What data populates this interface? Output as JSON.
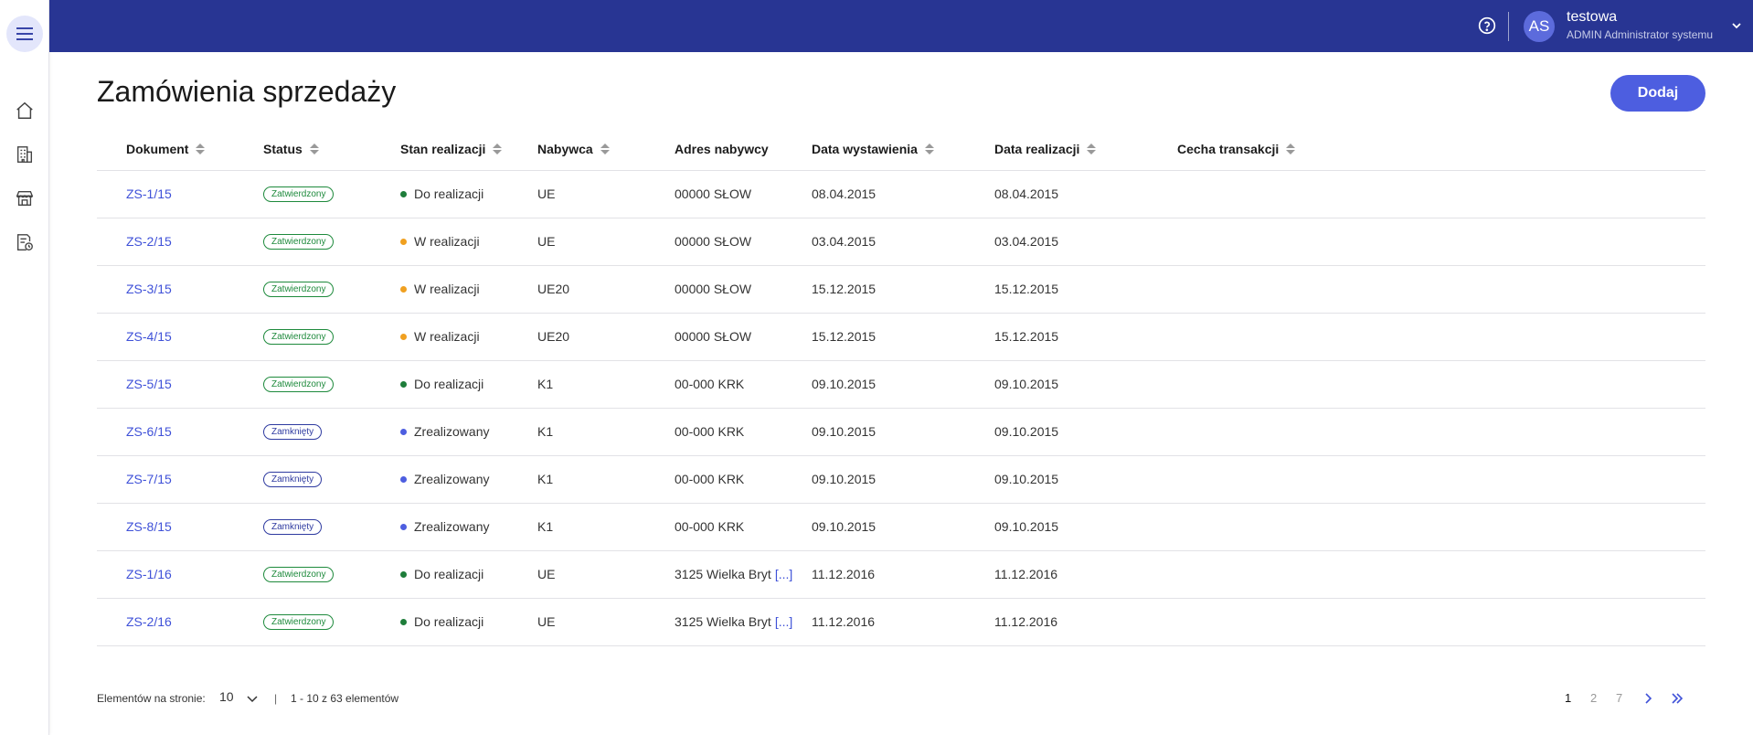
{
  "header": {
    "user_initials": "AS",
    "user_name": "testowa",
    "user_role": "ADMIN Administrator systemu"
  },
  "sidebar": {
    "items": [
      {
        "icon": "home-icon"
      },
      {
        "icon": "building-icon"
      },
      {
        "icon": "store-icon"
      },
      {
        "icon": "document-clock-icon"
      }
    ]
  },
  "page": {
    "title": "Zamówienia sprzedaży",
    "add_label": "Dodaj"
  },
  "table": {
    "columns": [
      "Dokument",
      "Status",
      "Stan realizacji",
      "Nabywca",
      "Adres nabywcy",
      "Data wystawienia",
      "Data realizacji",
      "Cecha transakcji"
    ],
    "rows": [
      {
        "doc": "ZS-1/15",
        "status": "Zatwierdzony",
        "status_type": "green",
        "stage": "Do realizacji",
        "stage_color": "#1e7d3a",
        "buyer": "UE",
        "address": "00000 SŁOW",
        "address_more": "",
        "issued": "08.04.2015",
        "completed": "08.04.2015"
      },
      {
        "doc": "ZS-2/15",
        "status": "Zatwierdzony",
        "status_type": "green",
        "stage": "W realizacji",
        "stage_color": "#f0a020",
        "buyer": "UE",
        "address": "00000 SŁOW",
        "address_more": "",
        "issued": "03.04.2015",
        "completed": "03.04.2015"
      },
      {
        "doc": "ZS-3/15",
        "status": "Zatwierdzony",
        "status_type": "green",
        "stage": "W realizacji",
        "stage_color": "#f0a020",
        "buyer": "UE20",
        "address": "00000 SŁOW",
        "address_more": "",
        "issued": "15.12.2015",
        "completed": "15.12.2015"
      },
      {
        "doc": "ZS-4/15",
        "status": "Zatwierdzony",
        "status_type": "green",
        "stage": "W realizacji",
        "stage_color": "#f0a020",
        "buyer": "UE20",
        "address": "00000 SŁOW",
        "address_more": "",
        "issued": "15.12.2015",
        "completed": "15.12.2015"
      },
      {
        "doc": "ZS-5/15",
        "status": "Zatwierdzony",
        "status_type": "green",
        "stage": "Do realizacji",
        "stage_color": "#1e7d3a",
        "buyer": "K1",
        "address": "00-000 KRK",
        "address_more": "",
        "issued": "09.10.2015",
        "completed": "09.10.2015"
      },
      {
        "doc": "ZS-6/15",
        "status": "Zamknięty",
        "status_type": "blue",
        "stage": "Zrealizowany",
        "stage_color": "#4d5ee0",
        "buyer": "K1",
        "address": "00-000 KRK",
        "address_more": "",
        "issued": "09.10.2015",
        "completed": "09.10.2015"
      },
      {
        "doc": "ZS-7/15",
        "status": "Zamknięty",
        "status_type": "blue",
        "stage": "Zrealizowany",
        "stage_color": "#4d5ee0",
        "buyer": "K1",
        "address": "00-000 KRK",
        "address_more": "",
        "issued": "09.10.2015",
        "completed": "09.10.2015"
      },
      {
        "doc": "ZS-8/15",
        "status": "Zamknięty",
        "status_type": "blue",
        "stage": "Zrealizowany",
        "stage_color": "#4d5ee0",
        "buyer": "K1",
        "address": "00-000 KRK",
        "address_more": "",
        "issued": "09.10.2015",
        "completed": "09.10.2015"
      },
      {
        "doc": "ZS-1/16",
        "status": "Zatwierdzony",
        "status_type": "green",
        "stage": "Do realizacji",
        "stage_color": "#1e7d3a",
        "buyer": "UE",
        "address": "3125 Wielka Bryt",
        "address_more": "[...]",
        "issued": "11.12.2016",
        "completed": "11.12.2016"
      },
      {
        "doc": "ZS-2/16",
        "status": "Zatwierdzony",
        "status_type": "green",
        "stage": "Do realizacji",
        "stage_color": "#1e7d3a",
        "buyer": "UE",
        "address": "3125 Wielka Bryt",
        "address_more": "[...]",
        "issued": "11.12.2016",
        "completed": "11.12.2016"
      }
    ]
  },
  "pagination": {
    "per_page_label": "Elementów na stronie:",
    "per_page_value": "10",
    "separator": "|",
    "range_text": "1 - 10 z 63 elementów",
    "pages": [
      "1",
      "2",
      "7"
    ],
    "current_page": "1"
  },
  "colors": {
    "header_bg": "#283593",
    "accent": "#4d5ee0",
    "status_green": "#1e8a3c",
    "status_blue": "#2e3aa0"
  }
}
